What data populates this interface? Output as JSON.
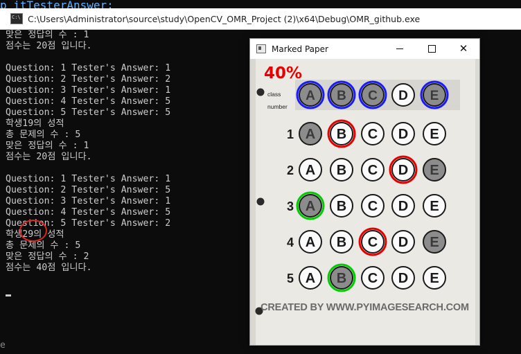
{
  "console": {
    "title": "C:\\Users\\Administrator\\source\\study\\OpenCV_OMR_Project (2)\\x64\\Debug\\OMR_github.exe",
    "top_peek": "p itTesterAnswer;",
    "lines": [
      "맞은 정답의 수 : 1",
      "점수는 20점 입니다.",
      "",
      "Question: 1 Tester's Answer: 1",
      "Question: 2 Tester's Answer: 2",
      "Question: 3 Tester's Answer: 1",
      "Question: 4 Tester's Answer: 5",
      "Question: 5 Tester's Answer: 5",
      "학생19의 성적",
      "총 문제의 수 : 5",
      "맞은 정답의 수 : 1",
      "점수는 20점 입니다.",
      "",
      "Question: 1 Tester's Answer: 1",
      "Question: 2 Tester's Answer: 5",
      "Question: 3 Tester's Answer: 1",
      "Question: 4 Tester's Answer: 5",
      "Question: 5 Tester's Answer: 2",
      "학생29의 성적",
      "총 문제의 수 : 5",
      "맞은 정답의 수 : 2",
      "점수는 40점 입니다."
    ],
    "left_edge_char": "e"
  },
  "paper_window": {
    "title": "Marked Paper",
    "score": "40%",
    "class_label": "class",
    "number_label": "number",
    "footer": "CREATED BY WWW.PYIMAGESEARCH.COM",
    "controls": {
      "minimize": "—",
      "maximize": "☐",
      "close": "✕"
    }
  },
  "omr": {
    "options": [
      "A",
      "B",
      "C",
      "D",
      "E"
    ],
    "header_row": {
      "filled": [
        0,
        1,
        2,
        4
      ],
      "blue_marked": [
        0,
        1,
        2,
        4
      ]
    },
    "questions": [
      {
        "number": "1",
        "filled": [
          0
        ],
        "red": [
          1
        ],
        "green": []
      },
      {
        "number": "2",
        "filled": [
          4
        ],
        "red": [
          3
        ],
        "green": []
      },
      {
        "number": "3",
        "filled": [
          0
        ],
        "red": [],
        "green": [
          0
        ]
      },
      {
        "number": "4",
        "filled": [
          4
        ],
        "red": [
          2
        ],
        "green": []
      },
      {
        "number": "5",
        "filled": [
          1
        ],
        "red": [],
        "green": [
          1
        ]
      }
    ],
    "colors": {
      "red": "#e60000",
      "green": "#00cc00",
      "blue": "#1a1aff",
      "filled": "#8c8c8c"
    }
  }
}
